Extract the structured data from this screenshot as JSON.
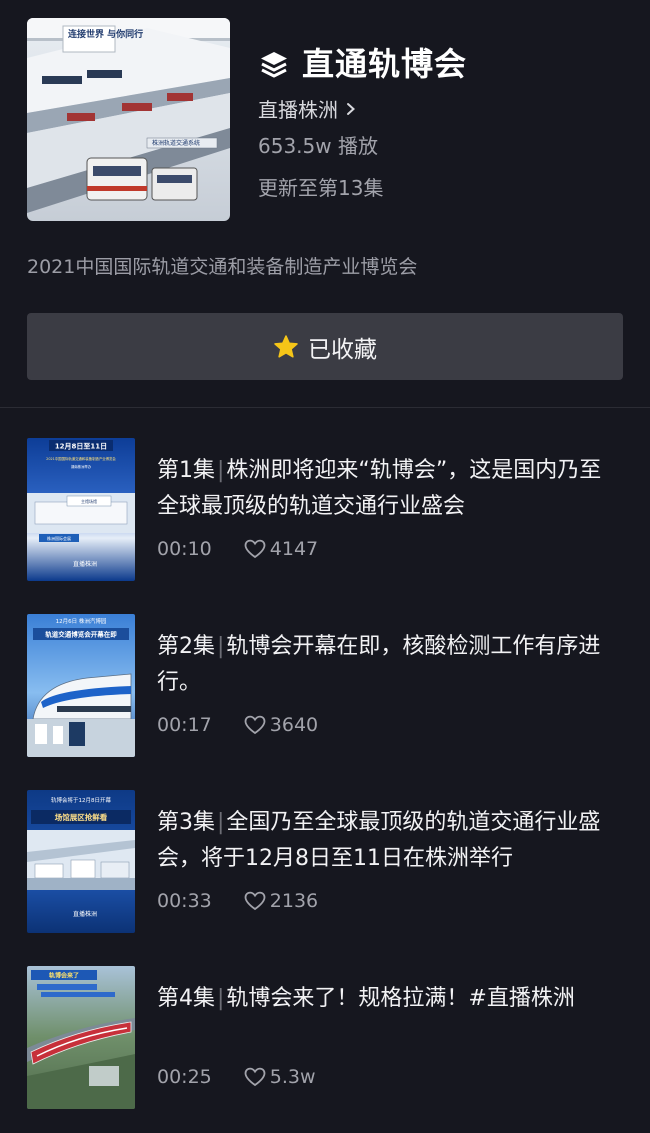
{
  "header": {
    "title": "直通轨博会",
    "channel": "直播株洲",
    "plays": "653.5w 播放",
    "update": "更新至第13集",
    "description": "2021中国国际轨道交通和装备制造产业博览会",
    "cover_texts": [
      "连接世界 与你同行",
      "株洲轨道交通系统"
    ],
    "icons": {
      "title": "layers-icon",
      "channel": "chevron-right-icon"
    }
  },
  "favorite": {
    "label": "已收藏",
    "icon": "star-icon",
    "icon_color": "#f5c518"
  },
  "episodes": [
    {
      "label": "第1集",
      "sep": "|",
      "title": "株洲即将迎来“轨博会”，这是国内乃至全球最顶级的轨道交通行业盛会",
      "duration": "00:10",
      "likes": "4147",
      "thumb": {
        "top": "12月8日至11日",
        "sub": "2021中国国际轨道交通和装备制造产业博览会",
        "sub2": "湖南株洲举办",
        "sign": "主馆场馆",
        "badge": "株洲国际会展",
        "brand": "直播株洲"
      }
    },
    {
      "label": "第2集",
      "sep": "|",
      "title": "轨博会开幕在即，核酸检测工作有序进行。",
      "duration": "00:17",
      "likes": "3640",
      "thumb": {
        "top": "12月6日 株洲汽博园",
        "sub": "轨道交通博览会开幕在即"
      }
    },
    {
      "label": "第3集",
      "sep": "|",
      "title": "全国乃至全球最顶级的轨道交通行业盛会，将于12月8日至11日在株洲举行",
      "duration": "00:33",
      "likes": "2136",
      "thumb": {
        "top": "轨博会将于12月8日开幕",
        "sub": "场馆展区抢鲜看",
        "brand": "直播株洲"
      }
    },
    {
      "label": "第4集",
      "sep": "|",
      "title": "轨博会来了！规格拉满！#直播株洲",
      "duration": "00:25",
      "likes": "5.3w",
      "thumb": {
        "top": "轨博会来了"
      }
    }
  ],
  "colors": {
    "background": "#16171f",
    "button": "#3b3c44",
    "muted": "#a2a3ab"
  }
}
